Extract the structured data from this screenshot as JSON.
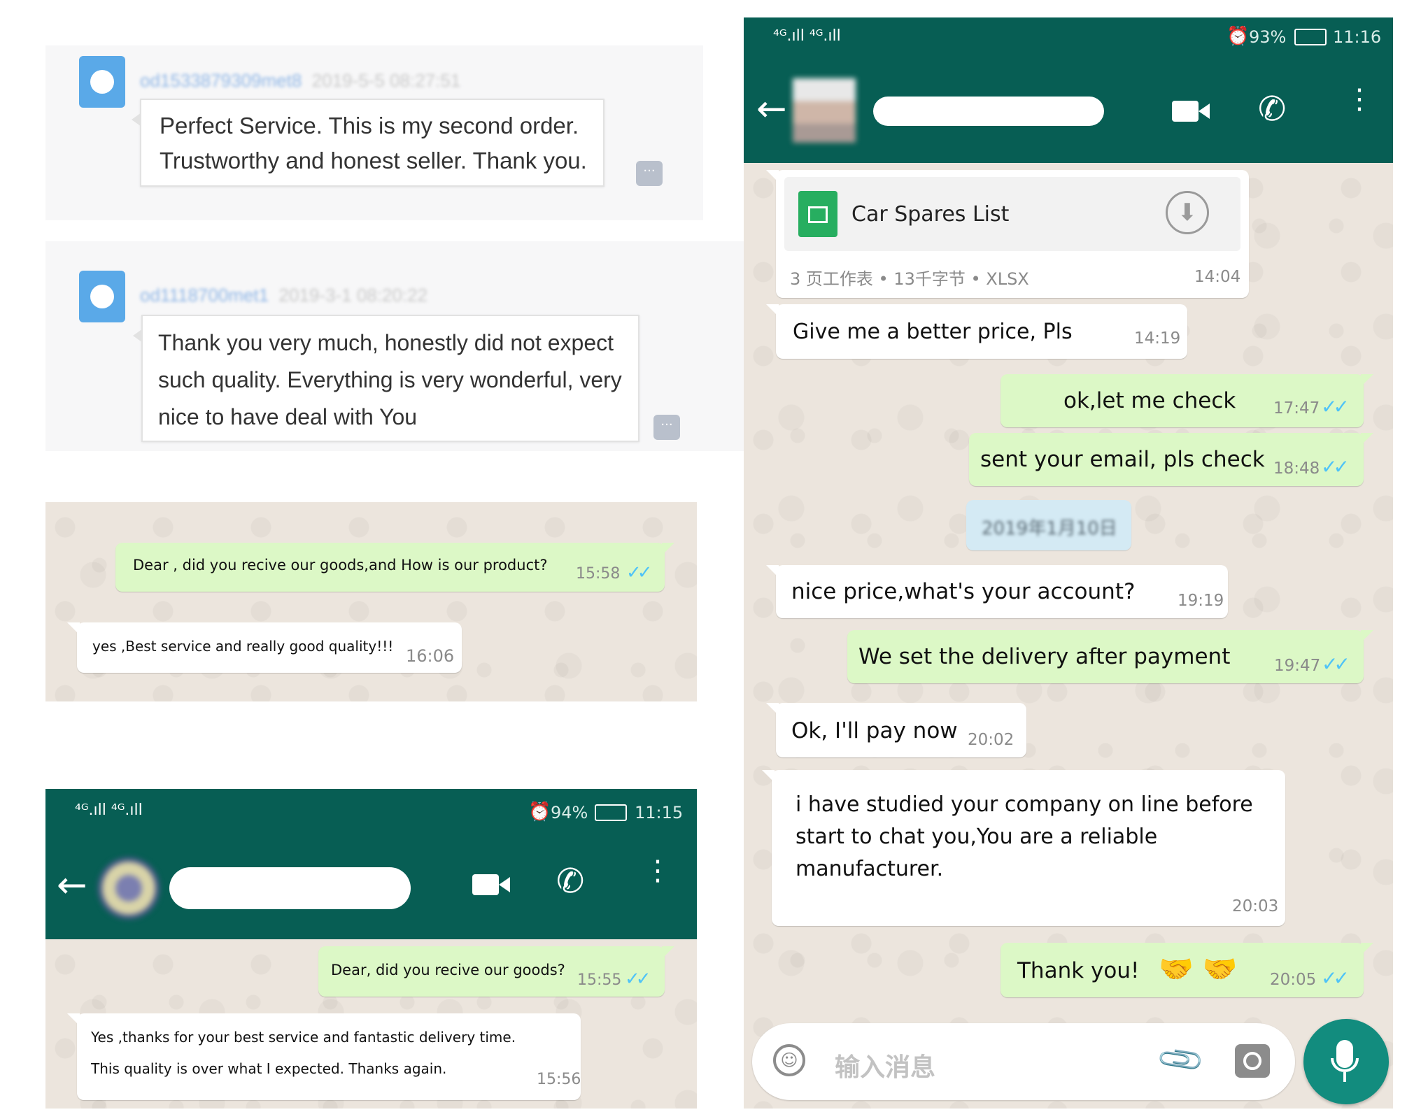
{
  "reviews": [
    {
      "username": "od1533879309met8",
      "date": "2019-5-5 08:27:51",
      "text_line1": "Perfect Service. This is my second order.",
      "text_line2": "Trustworthy and honest seller. Thank you.",
      "more": "···"
    },
    {
      "username": "od1118700met1",
      "date": "2019-3-1 08:20:22",
      "text_line1": "Thank you very much, honestly did not expect",
      "text_line2": "such quality. Everything is very wonderful, very",
      "text_line3": "nice to have deal with You",
      "more": "···"
    }
  ],
  "chat_a": {
    "messages": [
      {
        "text": "Dear ,  did you recive our goods,and How is our product?",
        "time": "15:58",
        "ticks": "✓✓"
      },
      {
        "text": "yes ,Best service and really good quality!!!",
        "time": "16:06"
      }
    ]
  },
  "chat_b": {
    "status": {
      "signal": "⁴ᴳ.ıll ⁴ᴳ.ıll",
      "battery": "94%",
      "time": "11:15"
    },
    "messages": [
      {
        "text": "Dear, did you recive our goods?",
        "time": "15:55",
        "ticks": "✓✓"
      },
      {
        "text_line1": "Yes ,thanks for your best service and fantastic delivery time.",
        "text_line2": "This quality is over what I expected. Thanks again.",
        "time": "15:56"
      }
    ]
  },
  "chat_c": {
    "status": {
      "signal": "⁴ᴳ.ıll ⁴ᴳ.ıll",
      "battery": "93%",
      "time": "11:16"
    },
    "file": {
      "name": "Car Spares List",
      "meta": "3 页工作表 • 13千字节 • XLSX",
      "time": "14:04"
    },
    "messages": [
      {
        "id": "m1",
        "text": "Give me a better price, Pls",
        "time": "14:19"
      },
      {
        "id": "m2",
        "text": "ok,let me check",
        "time": "17:47",
        "ticks": "✓✓"
      },
      {
        "id": "m3",
        "text": "sent your email, pls check",
        "time": "18:48",
        "ticks": "✓✓"
      },
      {
        "id": "m4",
        "text": "2019年1月10日",
        "time": ""
      },
      {
        "id": "m5",
        "text": "nice price,what's your account?",
        "time": "19:19"
      },
      {
        "id": "m6",
        "text": "We  set the delivery after payment",
        "time": "19:47",
        "ticks": "✓✓"
      },
      {
        "id": "m7",
        "text": "Ok, I'll pay now",
        "time": "20:02"
      },
      {
        "id": "m8",
        "text_line1": "i have studied your company on line before",
        "text_line2": "start to chat you,You are a reliable",
        "text_line3": "manufacturer.",
        "time": "20:03"
      },
      {
        "id": "m9",
        "text": "Thank you!",
        "emoji": "🤝 🤝",
        "time": "20:05",
        "ticks": "✓✓"
      }
    ],
    "input_placeholder": "输入消息"
  },
  "colors": {
    "header": "#075e54",
    "outgoing": "#dcf8c6",
    "incoming": "#ffffff",
    "chat_bg": "#ece5dd",
    "tick": "#4fc3f7",
    "mic": "#128c7e"
  }
}
